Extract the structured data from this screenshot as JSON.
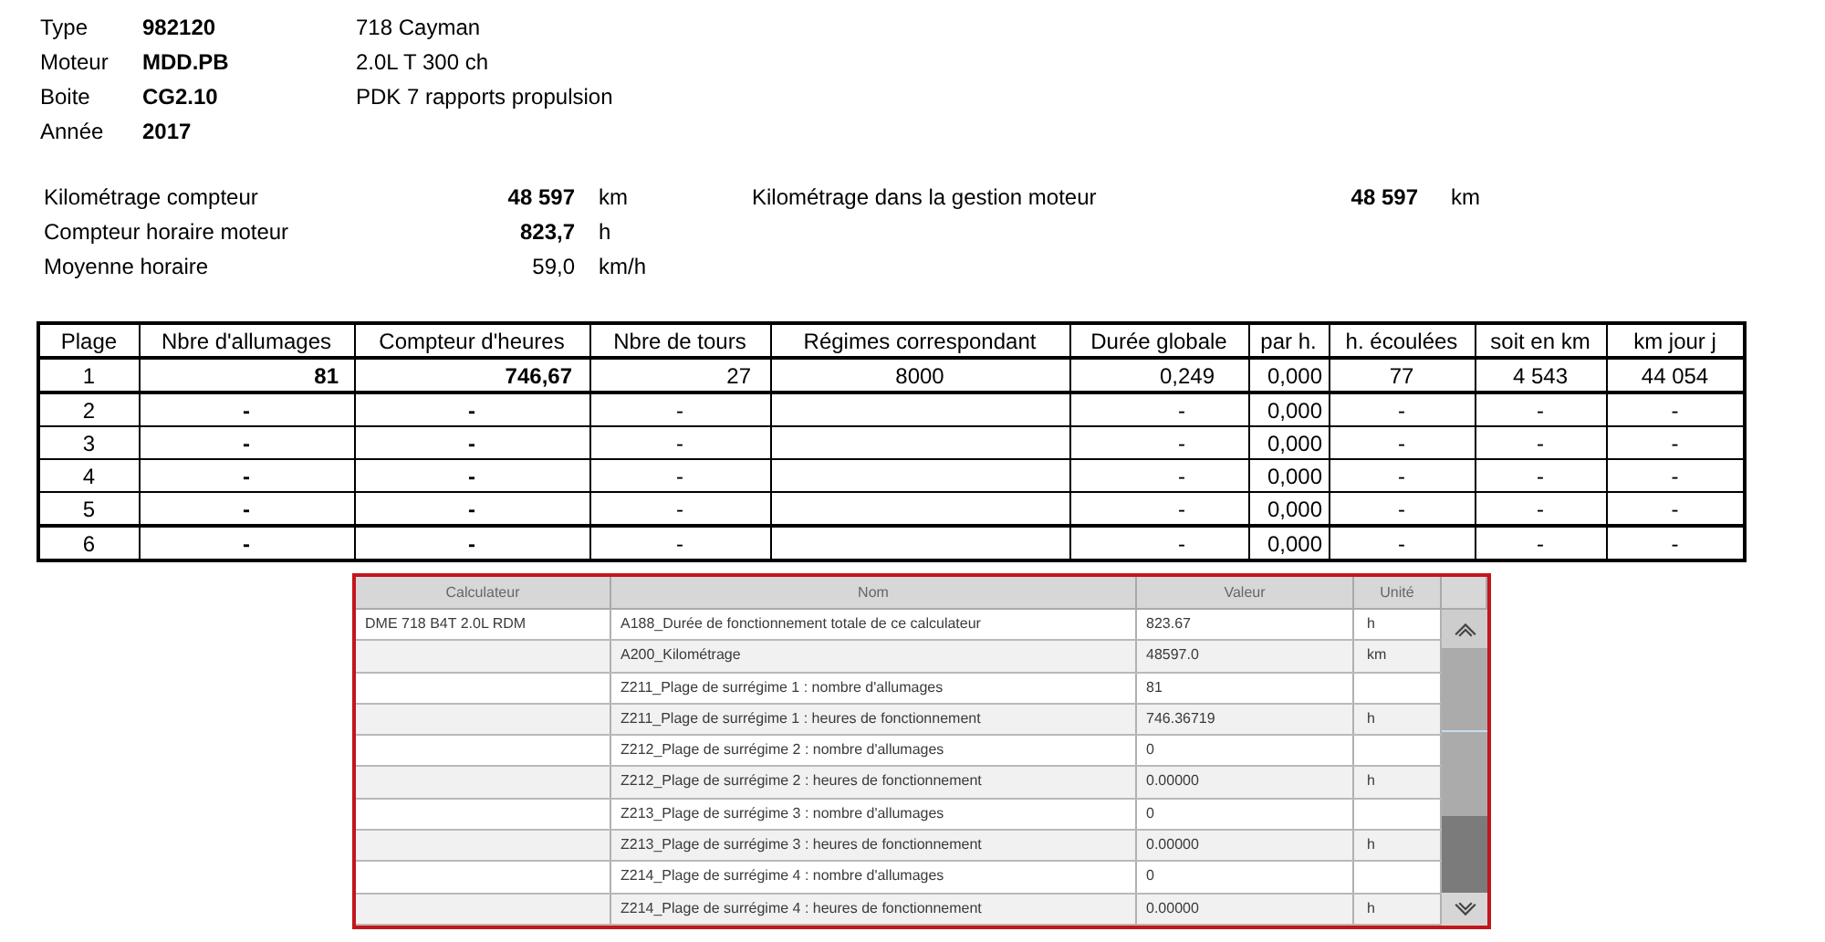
{
  "vehicle": [
    {
      "label": "Type",
      "code": "982120",
      "description": "718 Cayman"
    },
    {
      "label": "Moteur",
      "code": "MDD.PB",
      "description": "2.0L T 300 ch"
    },
    {
      "label": "Boite",
      "code": "CG2.10",
      "description": "PDK 7 rapports propulsion"
    },
    {
      "label": "Année",
      "code": "2017"
    }
  ],
  "readings": [
    {
      "label": "Kilométrage compteur",
      "value": "48 597",
      "unit": "km",
      "bold": true
    },
    {
      "label": "Compteur horaire moteur",
      "value": "823,7",
      "unit": "h",
      "bold": true
    },
    {
      "label": "Moyenne horaire",
      "value": "59,0",
      "unit": "km/h",
      "bold": false
    }
  ],
  "engine_reading": {
    "label": "Kilométrage dans la gestion moteur",
    "value": "48 597",
    "unit": "km",
    "bold": true
  },
  "range_table": {
    "columns": [
      "Plage",
      "Nbre d'allumages",
      "Compteur d'heures",
      "Nbre de tours",
      "Régimes correspondant",
      "Durée globale",
      "par h.",
      "h. écoulées",
      "soit en km",
      "km jour j"
    ],
    "rows": [
      [
        "1",
        "81",
        "746,67",
        "27",
        "8000",
        "0,249",
        "0,000",
        "77",
        "4 543",
        "44 054"
      ],
      [
        "2",
        "-",
        "-",
        "-",
        null,
        "-",
        "0,000",
        "-",
        "-",
        "-"
      ],
      [
        "3",
        "-",
        "-",
        "-",
        null,
        "-",
        "0,000",
        "-",
        "-",
        "-"
      ],
      [
        "4",
        "-",
        "-",
        "-",
        null,
        "-",
        "0,000",
        "-",
        "-",
        "-"
      ],
      [
        "5",
        "-",
        "-",
        "-",
        null,
        "-",
        "0,000",
        "-",
        "-",
        "-"
      ],
      [
        "6",
        "-",
        "-",
        "-",
        null,
        "-",
        "0,000",
        "-",
        "-",
        "-"
      ]
    ]
  },
  "ecu_table": {
    "columns": [
      "Calculateur",
      "Nom",
      "Valeur",
      "Unité"
    ],
    "rows": [
      {
        "calculator": "DME 718 B4T 2.0L RDM",
        "name": "A188_Durée de fonctionnement totale de ce calculateur",
        "value": "823.67",
        "unit": "h"
      },
      {
        "name": "A200_Kilométrage",
        "value": "48597.0",
        "unit": "km"
      },
      {
        "name": "Z211_Plage de surrégime 1 : nombre d'allumages",
        "value": "81"
      },
      {
        "name": "Z211_Plage de surrégime 1 : heures de fonctionnement",
        "value": "746.36719",
        "unit": "h"
      },
      {
        "name": "Z212_Plage de surrégime 2 : nombre d'allumages",
        "value": "0"
      },
      {
        "name": "Z212_Plage de surrégime 2 : heures de fonctionnement",
        "value": "0.00000",
        "unit": "h"
      },
      {
        "name": "Z213_Plage de surrégime 3 : nombre d'allumages",
        "value": "0"
      },
      {
        "name": "Z213_Plage de surrégime 3 : heures de fonctionnement",
        "value": "0.00000",
        "unit": "h"
      },
      {
        "name": "Z214_Plage de surrégime 4 : nombre d'allumages",
        "value": "0"
      },
      {
        "name": "Z214_Plage de surrégime 4 : heures de fonctionnement",
        "value": "0.00000",
        "unit": "h"
      }
    ]
  }
}
